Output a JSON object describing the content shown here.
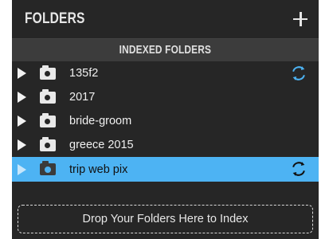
{
  "header": {
    "title": "FOLDERS",
    "add_icon": "plus-icon"
  },
  "section": {
    "title": "INDEXED FOLDERS"
  },
  "folders": [
    {
      "name": "135f2",
      "expander_icon": "triangle-right-icon",
      "folder_icon": "camera-folder-icon",
      "syncing": true,
      "selected": false
    },
    {
      "name": "2017",
      "expander_icon": "triangle-right-icon",
      "folder_icon": "camera-folder-icon",
      "syncing": false,
      "selected": false
    },
    {
      "name": "bride-groom",
      "expander_icon": "triangle-right-icon",
      "folder_icon": "camera-folder-icon",
      "syncing": false,
      "selected": false
    },
    {
      "name": "greece 2015",
      "expander_icon": "triangle-right-icon",
      "folder_icon": "camera-folder-icon",
      "syncing": false,
      "selected": false
    },
    {
      "name": "trip web pix",
      "expander_icon": "triangle-right-icon",
      "folder_icon": "camera-folder-icon",
      "syncing": true,
      "selected": true
    }
  ],
  "drop_zone": {
    "label": "Drop Your Folders Here to Index"
  },
  "colors": {
    "panel_bg": "#262626",
    "section_bg": "#3c3c3c",
    "selection": "#4db3f3",
    "sync_accent": "#4db3f3"
  }
}
